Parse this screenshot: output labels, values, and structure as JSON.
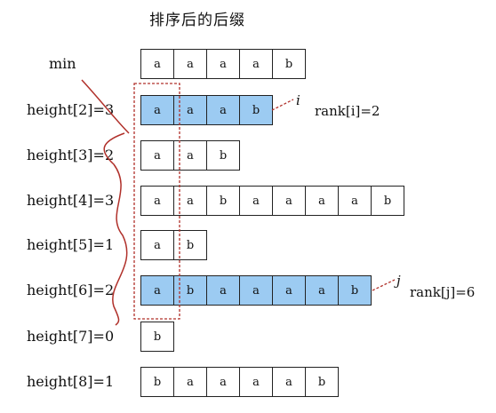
{
  "title": "排序后的后缀",
  "min_label": "min",
  "rows": [
    {
      "label": "",
      "cells": [
        "a",
        "a",
        "a",
        "a",
        "b"
      ],
      "highlight": false
    },
    {
      "label": "height[2]=3",
      "cells": [
        "a",
        "a",
        "a",
        "b"
      ],
      "highlight": true
    },
    {
      "label": "height[3]=2",
      "cells": [
        "a",
        "a",
        "b"
      ],
      "highlight": false
    },
    {
      "label": "height[4]=3",
      "cells": [
        "a",
        "a",
        "b",
        "a",
        "a",
        "a",
        "a",
        "b"
      ],
      "highlight": false
    },
    {
      "label": "height[5]=1",
      "cells": [
        "a",
        "b"
      ],
      "highlight": false
    },
    {
      "label": "height[6]=2",
      "cells": [
        "a",
        "b",
        "a",
        "a",
        "a",
        "a",
        "b"
      ],
      "highlight": true
    },
    {
      "label": "height[7]=0",
      "cells": [
        "b"
      ],
      "highlight": false
    },
    {
      "label": "height[8]=1",
      "cells": [
        "b",
        "a",
        "a",
        "a",
        "a",
        "b"
      ],
      "highlight": false
    }
  ],
  "marker_i": "i",
  "marker_j": "j",
  "rank_i": "rank[i]=2",
  "rank_j": "rank[j]=6",
  "colors": {
    "highlight": "#9ccbf2",
    "annotation": "#b0302a"
  }
}
